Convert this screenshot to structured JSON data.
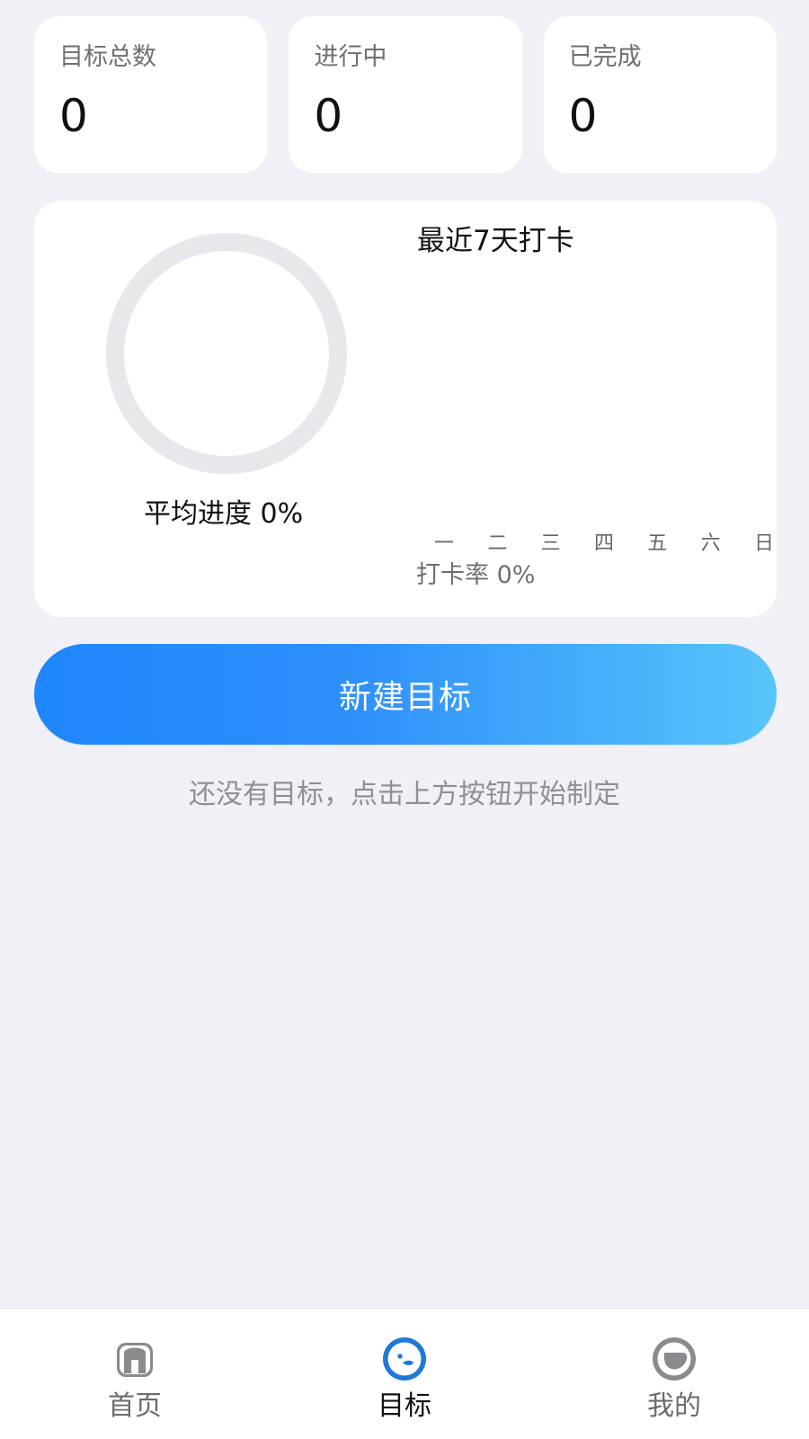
{
  "stats": [
    {
      "label": "目标总数",
      "value": "0"
    },
    {
      "label": "进行中",
      "value": "0"
    },
    {
      "label": "已完成",
      "value": "0"
    }
  ],
  "progress": {
    "avg_label": "平均进度 0%",
    "week_title": "最近7天打卡",
    "days": [
      "一",
      "二",
      "三",
      "四",
      "五",
      "六",
      "日"
    ],
    "checkin_rate_label": "打卡率 0%"
  },
  "actions": {
    "new_goal_label": "新建目标",
    "empty_hint": "还没有目标，点击上方按钮开始制定"
  },
  "bottom_nav": [
    {
      "label": "首页",
      "icon": "home-icon",
      "active": false
    },
    {
      "label": "目标",
      "icon": "target-icon",
      "active": true
    },
    {
      "label": "我的",
      "icon": "profile-icon",
      "active": false
    }
  ],
  "colors": {
    "background": "#f0f0f6",
    "card": "#ffffff",
    "button_start": "#1f86fb",
    "button_end": "#57c5fb",
    "active_icon": "#1e79d8",
    "inactive_icon": "#8a8a8f"
  }
}
